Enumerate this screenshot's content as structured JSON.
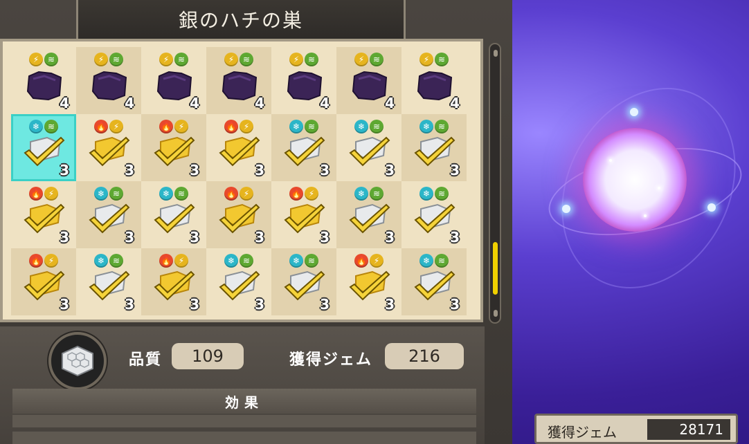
{
  "title": "銀のハチの巣",
  "grid": [
    [
      {
        "icons": [
          "bolt-icon",
          "wind-icon"
        ],
        "item": "dark-chunk",
        "count": "4"
      },
      {
        "icons": [
          "bolt-icon",
          "wind-icon"
        ],
        "item": "dark-chunk",
        "count": "4"
      },
      {
        "icons": [
          "bolt-icon",
          "wind-icon"
        ],
        "item": "dark-chunk",
        "count": "4"
      },
      {
        "icons": [
          "bolt-icon",
          "wind-icon"
        ],
        "item": "dark-chunk",
        "count": "4"
      },
      {
        "icons": [
          "bolt-icon",
          "wind-icon"
        ],
        "item": "dark-chunk",
        "count": "4"
      },
      {
        "icons": [
          "bolt-icon",
          "wind-icon"
        ],
        "item": "dark-chunk",
        "count": "4"
      },
      {
        "icons": [
          "bolt-icon",
          "wind-icon"
        ],
        "item": "dark-chunk",
        "count": "4"
      }
    ],
    [
      {
        "icons": [
          "ice-icon",
          "wind-icon"
        ],
        "item": "silver-honeycomb",
        "count": "3",
        "selected": true
      },
      {
        "icons": [
          "fire-icon",
          "bolt-icon"
        ],
        "item": "gold-honeycomb",
        "count": "3"
      },
      {
        "icons": [
          "fire-icon",
          "bolt-icon"
        ],
        "item": "gold-honeycomb",
        "count": "3"
      },
      {
        "icons": [
          "fire-icon",
          "bolt-icon"
        ],
        "item": "gold-honeycomb",
        "count": "3"
      },
      {
        "icons": [
          "ice-icon",
          "wind-icon"
        ],
        "item": "silver-honeycomb",
        "count": "3"
      },
      {
        "icons": [
          "ice-icon",
          "wind-icon"
        ],
        "item": "silver-honeycomb",
        "count": "3"
      },
      {
        "icons": [
          "ice-icon",
          "wind-icon"
        ],
        "item": "silver-honeycomb",
        "count": "3"
      }
    ],
    [
      {
        "icons": [
          "fire-icon",
          "bolt-icon"
        ],
        "item": "gold-honeycomb",
        "count": "3"
      },
      {
        "icons": [
          "ice-icon",
          "wind-icon"
        ],
        "item": "silver-honeycomb",
        "count": "3"
      },
      {
        "icons": [
          "ice-icon",
          "wind-icon"
        ],
        "item": "silver-honeycomb",
        "count": "3"
      },
      {
        "icons": [
          "fire-icon",
          "bolt-icon"
        ],
        "item": "gold-honeycomb",
        "count": "3"
      },
      {
        "icons": [
          "fire-icon",
          "bolt-icon"
        ],
        "item": "gold-honeycomb",
        "count": "3"
      },
      {
        "icons": [
          "ice-icon",
          "wind-icon"
        ],
        "item": "silver-honeycomb",
        "count": "3"
      },
      {
        "icons": [
          "ice-icon",
          "wind-icon"
        ],
        "item": "silver-honeycomb",
        "count": "3"
      }
    ],
    [
      {
        "icons": [
          "fire-icon",
          "bolt-icon"
        ],
        "item": "gold-honeycomb",
        "count": "3"
      },
      {
        "icons": [
          "ice-icon",
          "wind-icon"
        ],
        "item": "silver-honeycomb",
        "count": "3"
      },
      {
        "icons": [
          "fire-icon",
          "bolt-icon"
        ],
        "item": "gold-honeycomb",
        "count": "3"
      },
      {
        "icons": [
          "ice-icon",
          "wind-icon"
        ],
        "item": "silver-honeycomb",
        "count": "3"
      },
      {
        "icons": [
          "ice-icon",
          "wind-icon"
        ],
        "item": "silver-honeycomb",
        "count": "3"
      },
      {
        "icons": [
          "fire-icon",
          "bolt-icon"
        ],
        "item": "gold-honeycomb",
        "count": "3"
      },
      {
        "icons": [
          "ice-icon",
          "wind-icon"
        ],
        "item": "silver-honeycomb",
        "count": "3"
      }
    ]
  ],
  "details": {
    "quality_label": "品質",
    "quality_value": "109",
    "gems_label": "獲得ジェム",
    "gems_value": "216",
    "effect_label": "効果"
  },
  "total": {
    "label": "獲得ジェム",
    "value": "28171"
  },
  "colors": {
    "fire": "#e8492c",
    "bolt": "#e6b41e",
    "wind": "#5ea832",
    "ice": "#2cb6c8",
    "selected": "#6ee8e1",
    "scroll_thumb": "#f0d000"
  }
}
